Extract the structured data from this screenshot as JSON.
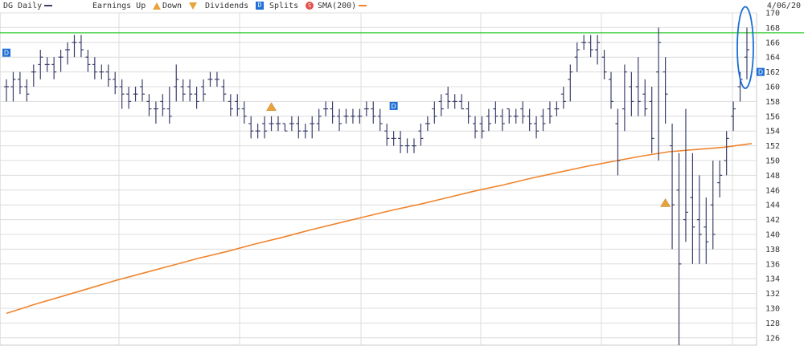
{
  "legend": {
    "symbol": "DG Daily",
    "earnings_up": "Earnings Up",
    "down": "Down",
    "dividends": "Dividends",
    "dividend_marker": "D",
    "splits": "Splits",
    "split_marker": "S",
    "sma": "SMA(200)",
    "date": "4/06/20"
  },
  "colors": {
    "price": "#3b3f6b",
    "sma": "#f0842c",
    "hline": "#33cc33",
    "earnings": "#e8a33a",
    "dividend": "#1f6fd6",
    "split": "#e0524b",
    "grid": "#dcdcdc",
    "annotation": "#1a6fd4"
  },
  "chart_data": {
    "type": "ohlc",
    "ylim": [
      125,
      170
    ],
    "yticks": [
      126,
      128,
      130,
      132,
      134,
      136,
      138,
      140,
      142,
      144,
      146,
      148,
      150,
      152,
      154,
      156,
      158,
      160,
      162,
      164,
      166,
      168,
      170
    ],
    "horizontal_line": 167.3,
    "bars": [
      [
        160,
        158,
        161,
        160
      ],
      [
        160,
        158,
        162,
        161
      ],
      [
        161,
        159,
        162,
        160
      ],
      [
        160,
        158,
        161,
        159
      ],
      [
        162,
        160,
        163,
        162
      ],
      [
        163,
        161,
        165,
        164
      ],
      [
        163,
        162,
        164,
        163
      ],
      [
        163,
        161,
        164,
        162
      ],
      [
        164,
        162,
        165,
        164
      ],
      [
        165,
        163,
        166,
        165
      ],
      [
        166,
        164,
        167,
        166
      ],
      [
        166,
        164,
        167,
        165
      ],
      [
        164,
        162,
        165,
        163
      ],
      [
        163,
        161,
        164,
        162
      ],
      [
        162,
        161,
        163,
        162
      ],
      [
        162,
        160,
        163,
        161
      ],
      [
        161,
        159,
        162,
        160
      ],
      [
        160,
        157,
        161,
        159
      ],
      [
        159,
        157,
        160,
        158
      ],
      [
        159,
        158,
        160,
        159
      ],
      [
        160,
        158,
        161,
        159
      ],
      [
        158,
        156,
        159,
        157
      ],
      [
        157,
        155,
        158,
        157
      ],
      [
        158,
        156,
        159,
        157
      ],
      [
        157,
        155,
        160,
        156
      ],
      [
        160,
        158,
        163,
        161
      ],
      [
        160,
        158,
        161,
        159
      ],
      [
        160,
        158,
        161,
        159
      ],
      [
        159,
        157,
        160,
        158
      ],
      [
        160,
        158,
        161,
        159
      ],
      [
        161,
        160,
        162,
        161
      ],
      [
        161,
        160,
        162,
        161
      ],
      [
        160,
        158,
        161,
        159
      ],
      [
        158,
        156,
        159,
        157
      ],
      [
        158,
        156,
        159,
        157
      ],
      [
        157,
        155,
        158,
        156
      ],
      [
        155,
        153,
        156,
        154
      ],
      [
        154,
        153,
        155,
        154
      ],
      [
        155,
        153,
        156,
        154
      ],
      [
        155,
        154,
        156,
        155
      ],
      [
        155,
        154,
        156,
        155
      ],
      [
        155,
        154,
        155,
        154
      ],
      [
        155,
        154,
        156,
        155
      ],
      [
        155,
        153,
        156,
        154
      ],
      [
        154,
        153,
        155,
        154
      ],
      [
        155,
        153,
        156,
        155
      ],
      [
        155,
        154,
        157,
        156
      ],
      [
        157,
        156,
        158,
        157
      ],
      [
        157,
        155,
        158,
        156
      ],
      [
        156,
        154,
        157,
        155
      ],
      [
        156,
        155,
        157,
        156
      ],
      [
        156,
        155,
        157,
        156
      ],
      [
        156,
        155,
        157,
        156
      ],
      [
        157,
        156,
        158,
        157
      ],
      [
        157,
        155,
        158,
        156
      ],
      [
        156,
        154,
        157,
        155
      ],
      [
        154,
        152,
        155,
        153
      ],
      [
        153,
        152,
        154,
        153
      ],
      [
        153,
        151,
        154,
        152
      ],
      [
        152,
        151,
        153,
        152
      ],
      [
        152,
        151,
        153,
        152
      ],
      [
        154,
        152,
        155,
        153
      ],
      [
        155,
        154,
        156,
        155
      ],
      [
        157,
        155,
        158,
        156
      ],
      [
        158,
        156,
        159,
        157
      ],
      [
        159,
        157,
        160,
        158
      ],
      [
        158,
        157,
        159,
        158
      ],
      [
        158,
        157,
        159,
        157
      ],
      [
        157,
        155,
        158,
        156
      ],
      [
        155,
        153,
        156,
        154
      ],
      [
        155,
        153,
        156,
        154
      ],
      [
        156,
        154,
        157,
        155
      ],
      [
        157,
        155,
        158,
        156
      ],
      [
        156,
        154,
        157,
        155
      ],
      [
        157,
        155,
        157,
        156
      ],
      [
        156,
        155,
        157,
        156
      ],
      [
        157,
        155,
        158,
        156
      ],
      [
        156,
        154,
        157,
        155
      ],
      [
        155,
        153,
        156,
        154
      ],
      [
        156,
        154,
        157,
        155
      ],
      [
        157,
        155,
        158,
        156
      ],
      [
        157,
        156,
        158,
        157
      ],
      [
        159,
        157,
        160,
        158
      ],
      [
        161,
        158,
        163,
        162
      ],
      [
        164,
        162,
        166,
        165
      ],
      [
        166,
        165,
        167,
        166
      ],
      [
        166,
        164,
        167,
        165
      ],
      [
        165,
        163,
        167,
        166
      ],
      [
        164,
        161,
        165,
        162
      ],
      [
        161,
        157,
        162,
        158
      ],
      [
        155,
        148,
        157,
        150
      ],
      [
        157,
        154,
        163,
        162
      ],
      [
        160,
        156,
        162,
        158
      ],
      [
        160,
        156,
        164,
        158
      ],
      [
        159,
        156,
        161,
        157
      ],
      [
        158,
        151,
        160,
        153
      ],
      [
        162,
        150,
        168,
        166
      ],
      [
        162,
        155,
        164,
        159
      ],
      [
        152,
        138,
        155,
        144
      ],
      [
        146,
        125,
        151,
        136
      ],
      [
        142,
        139,
        157,
        143
      ],
      [
        145,
        136,
        151,
        141
      ],
      [
        142,
        136,
        148,
        140
      ],
      [
        141,
        136,
        145,
        139
      ],
      [
        144,
        138,
        150,
        140
      ],
      [
        147,
        145,
        150,
        148
      ],
      [
        150,
        148,
        154,
        153
      ],
      [
        156,
        154,
        158,
        157
      ],
      [
        160,
        158,
        162,
        161
      ],
      [
        164,
        161,
        168,
        165
      ]
    ],
    "sma": [
      129.3,
      130.5,
      131.6,
      132.7,
      133.8,
      134.8,
      135.8,
      136.8,
      137.7,
      138.7,
      139.6,
      140.6,
      141.5,
      142.4,
      143.3,
      144.1,
      145,
      145.9,
      146.7,
      147.6,
      148.4,
      149.2,
      149.9,
      150.6,
      151.2,
      151.5,
      151.8,
      152.3
    ],
    "earnings": [
      {
        "idx": 39,
        "y": 157.3
      },
      {
        "idx": 97,
        "y": 144.3
      }
    ],
    "dividends": [
      {
        "idx": 0,
        "y": 164.6
      },
      {
        "idx": 57,
        "y": 157.4
      },
      {
        "idx": 111,
        "y": 162.0
      }
    ]
  }
}
